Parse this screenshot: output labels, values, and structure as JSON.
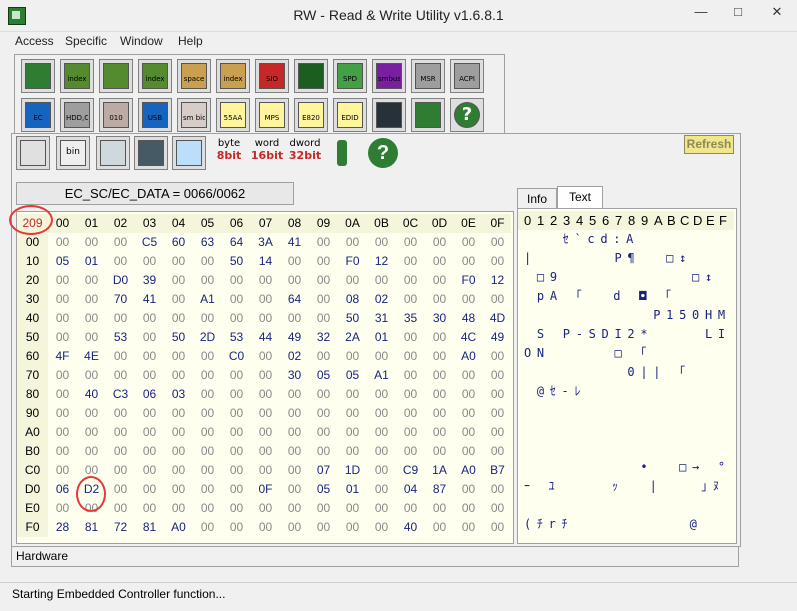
{
  "window": {
    "title": "RW - Read & Write Utility v1.6.8.1"
  },
  "menu": [
    "Access",
    "Specific",
    "Window",
    "Help"
  ],
  "toolbar_row1": [
    {
      "icon": "pci-card-icon",
      "label": "",
      "color": "#2e7d32"
    },
    {
      "icon": "pci-index-icon",
      "label": "index",
      "color": "#558b2f"
    },
    {
      "icon": "memory-icon",
      "label": "",
      "color": "#558b2f"
    },
    {
      "icon": "memory-index-icon",
      "label": "index",
      "color": "#558b2f"
    },
    {
      "icon": "io-space-icon",
      "label": "space",
      "color": "#c8a050"
    },
    {
      "icon": "io-index-icon",
      "label": "index",
      "color": "#c8a050"
    },
    {
      "icon": "super-io-icon",
      "label": "SIO",
      "color": "#c62828"
    },
    {
      "icon": "oscilloscope-icon",
      "label": "",
      "color": "#1b5e20"
    },
    {
      "icon": "spd-icon",
      "label": "SPD",
      "color": "#43a047"
    },
    {
      "icon": "smbus-icon",
      "label": "smbus",
      "color": "#7b1fa2"
    },
    {
      "icon": "msr-icon",
      "label": "MSR",
      "color": "#9e9e9e"
    },
    {
      "icon": "acpi-icon",
      "label": "ACPI",
      "color": "#9e9e9e"
    }
  ],
  "toolbar_row2": [
    {
      "icon": "ec-laptop-icon",
      "label": "EC",
      "color": "#1565c0"
    },
    {
      "icon": "disk-icon",
      "label": "HDD,CD",
      "color": "#9e9e9e"
    },
    {
      "icon": "cmos-icon",
      "label": "010",
      "color": "#bcaaa4"
    },
    {
      "icon": "usb-icon",
      "label": "USB",
      "color": "#1565c0"
    },
    {
      "icon": "smbios-icon",
      "label": "sm bios",
      "color": "#d7ccc8"
    },
    {
      "icon": "memory-55aa-icon",
      "label": "55AA",
      "color": "#fff59d"
    },
    {
      "icon": "mps-icon",
      "label": "MPS",
      "color": "#fff59d"
    },
    {
      "icon": "e820-icon",
      "label": "E820",
      "color": "#fff59d"
    },
    {
      "icon": "edid-icon",
      "label": "EDID",
      "color": "#fff59d"
    },
    {
      "icon": "command-icon",
      "label": "",
      "color": "#263238"
    },
    {
      "icon": "pci-table-icon",
      "label": "",
      "color": "#2e7d32"
    },
    {
      "icon": "help-icon",
      "label": "?",
      "color": "#2e7d32"
    }
  ],
  "inner_toolbar": {
    "buttons": [
      {
        "icon": "save-icon"
      },
      {
        "icon": "bin-file-icon",
        "label": "bin"
      },
      {
        "icon": "copy-icon"
      },
      {
        "icon": "binoculars-icon"
      },
      {
        "icon": "grid-view-icon"
      }
    ],
    "byte_label": [
      "byte",
      "8bit"
    ],
    "word_label": [
      "word",
      "16bit"
    ],
    "dword_label": [
      "dword",
      "32bit"
    ],
    "info_icon": "info-icon",
    "help_icon": "help-icon",
    "refresh_label": "Refresh"
  },
  "ec_address_label": "EC_SC/EC_DATA = 0066/0062",
  "hex_grid": {
    "corner": "209",
    "columns": [
      "00",
      "01",
      "02",
      "03",
      "04",
      "05",
      "06",
      "07",
      "08",
      "09",
      "0A",
      "0B",
      "0C",
      "0D",
      "0E",
      "0F"
    ],
    "rows": [
      {
        "label": "00",
        "cells": [
          "00",
          "00",
          "00",
          "C5",
          "60",
          "63",
          "64",
          "3A",
          "41",
          "00",
          "00",
          "00",
          "00",
          "00",
          "00",
          "00"
        ]
      },
      {
        "label": "10",
        "cells": [
          "05",
          "01",
          "00",
          "00",
          "00",
          "00",
          "50",
          "14",
          "00",
          "00",
          "F0",
          "12",
          "00",
          "00",
          "00",
          "00"
        ]
      },
      {
        "label": "20",
        "cells": [
          "00",
          "00",
          "D0",
          "39",
          "00",
          "00",
          "00",
          "00",
          "00",
          "00",
          "00",
          "00",
          "00",
          "00",
          "F0",
          "12"
        ]
      },
      {
        "label": "30",
        "cells": [
          "00",
          "00",
          "70",
          "41",
          "00",
          "A1",
          "00",
          "00",
          "64",
          "00",
          "08",
          "02",
          "00",
          "00",
          "00",
          "00"
        ]
      },
      {
        "label": "40",
        "cells": [
          "00",
          "00",
          "00",
          "00",
          "00",
          "00",
          "00",
          "00",
          "00",
          "00",
          "50",
          "31",
          "35",
          "30",
          "48",
          "4D"
        ]
      },
      {
        "label": "50",
        "cells": [
          "00",
          "00",
          "53",
          "00",
          "50",
          "2D",
          "53",
          "44",
          "49",
          "32",
          "2A",
          "01",
          "00",
          "00",
          "4C",
          "49"
        ]
      },
      {
        "label": "60",
        "cells": [
          "4F",
          "4E",
          "00",
          "00",
          "00",
          "00",
          "C0",
          "00",
          "02",
          "00",
          "00",
          "00",
          "00",
          "00",
          "A0",
          "00"
        ]
      },
      {
        "label": "70",
        "cells": [
          "00",
          "00",
          "00",
          "00",
          "00",
          "00",
          "00",
          "00",
          "30",
          "05",
          "05",
          "A1",
          "00",
          "00",
          "00",
          "00"
        ]
      },
      {
        "label": "80",
        "cells": [
          "00",
          "40",
          "C3",
          "06",
          "03",
          "00",
          "00",
          "00",
          "00",
          "00",
          "00",
          "00",
          "00",
          "00",
          "00",
          "00"
        ]
      },
      {
        "label": "90",
        "cells": [
          "00",
          "00",
          "00",
          "00",
          "00",
          "00",
          "00",
          "00",
          "00",
          "00",
          "00",
          "00",
          "00",
          "00",
          "00",
          "00"
        ]
      },
      {
        "label": "A0",
        "cells": [
          "00",
          "00",
          "00",
          "00",
          "00",
          "00",
          "00",
          "00",
          "00",
          "00",
          "00",
          "00",
          "00",
          "00",
          "00",
          "00"
        ]
      },
      {
        "label": "B0",
        "cells": [
          "00",
          "00",
          "00",
          "00",
          "00",
          "00",
          "00",
          "00",
          "00",
          "00",
          "00",
          "00",
          "00",
          "00",
          "00",
          "00"
        ]
      },
      {
        "label": "C0",
        "cells": [
          "00",
          "00",
          "00",
          "00",
          "00",
          "00",
          "00",
          "00",
          "00",
          "07",
          "1D",
          "00",
          "C9",
          "1A",
          "A0",
          "B7"
        ]
      },
      {
        "label": "D0",
        "cells": [
          "06",
          "D2",
          "00",
          "00",
          "00",
          "00",
          "00",
          "0F",
          "00",
          "05",
          "01",
          "00",
          "04",
          "87",
          "00",
          "00"
        ]
      },
      {
        "label": "E0",
        "cells": [
          "00",
          "00",
          "00",
          "00",
          "00",
          "00",
          "00",
          "00",
          "00",
          "00",
          "00",
          "00",
          "00",
          "00",
          "00",
          "00"
        ]
      },
      {
        "label": "F0",
        "cells": [
          "28",
          "81",
          "72",
          "81",
          "A0",
          "00",
          "00",
          "00",
          "00",
          "00",
          "00",
          "00",
          "40",
          "00",
          "00",
          "00"
        ]
      }
    ]
  },
  "text_panel": {
    "tabs": [
      "Info",
      "Text"
    ],
    "active_tab": "Text",
    "header": "0123456789ABCDEF",
    "rows": [
      "   ｾ`cd:A       ",
      "|      P¶  □↕   ",
      " □9          □↕",
      " pA ｢  d ◘ ｢     ",
      "          P150HM",
      " S P-SDI2*    LI",
      "ON     □ ｢      ",
      "        0|| ｢   ",
      " @ｾ-ﾚ           ",
      "                ",
      "                ",
      "                ",
      "         •  □→ °",
      "ｰ ﾕ    ｯ  |   ｣ﾇ",
      "                ",
      "(ﾁrﾁ         @   "
    ]
  },
  "hardware_label": "Hardware",
  "status_text": "Starting Embedded Controller function..."
}
